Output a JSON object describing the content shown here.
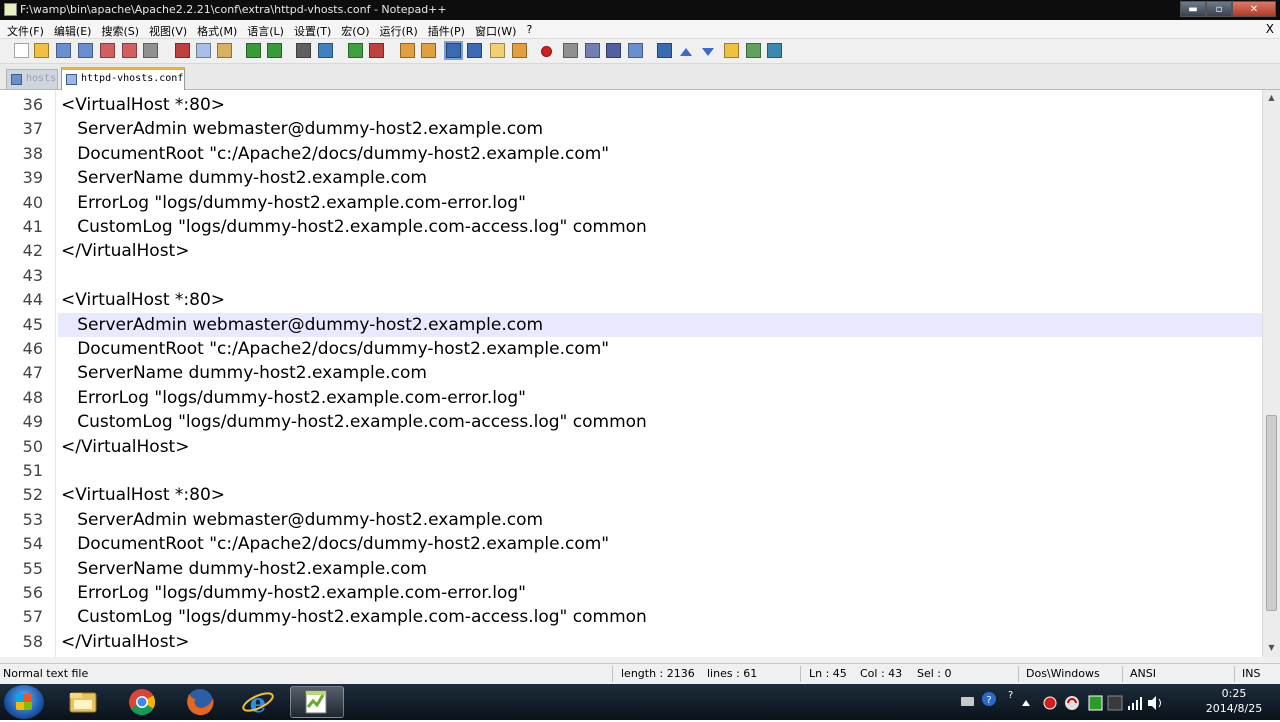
{
  "window": {
    "title": "F:\\wamp\\bin\\apache\\Apache2.2.21\\conf\\extra\\httpd-vhosts.conf - Notepad++",
    "minimize_glyph": "▬",
    "maximize_glyph": "▫",
    "close_glyph": "✕"
  },
  "menu": {
    "items": [
      "文件(F)",
      "编辑(E)",
      "搜索(S)",
      "视图(V)",
      "格式(M)",
      "语言(L)",
      "设置(T)",
      "宏(O)",
      "运行(R)",
      "插件(P)",
      "窗口(W)",
      "?"
    ],
    "close_glyph": "X"
  },
  "toolbar": {
    "icons": [
      "new-file-icon",
      "open-file-icon",
      "save-icon",
      "save-all-icon",
      "close-icon",
      "close-all-icon",
      "print-icon",
      "cut-icon",
      "copy-icon",
      "paste-icon",
      "undo-icon",
      "redo-icon",
      "find-icon",
      "replace-icon",
      "zoom-in-icon",
      "zoom-out-icon",
      "sync-vertical-icon",
      "sync-horizontal-icon",
      "word-wrap-icon",
      "show-all-chars-icon",
      "indent-guide-icon",
      "doc-map-icon",
      "record-macro-icon",
      "stop-macro-icon",
      "play-macro-icon",
      "run-macro-multiple-icon",
      "save-macro-icon",
      "function-list-icon",
      "prev-icon",
      "next-icon",
      "folder-icon",
      "npp-icon",
      "spellcheck-icon"
    ]
  },
  "tabs": [
    {
      "label": "hosts",
      "active": false
    },
    {
      "label": "httpd-vhosts.conf",
      "active": true
    }
  ],
  "editor": {
    "current_line": 45,
    "lines": [
      {
        "num": "36",
        "text": "<VirtualHost *:80>"
      },
      {
        "num": "37",
        "text": "   ServerAdmin webmaster@dummy-host2.example.com"
      },
      {
        "num": "38",
        "text": "   DocumentRoot \"c:/Apache2/docs/dummy-host2.example.com\""
      },
      {
        "num": "39",
        "text": "   ServerName dummy-host2.example.com"
      },
      {
        "num": "40",
        "text": "   ErrorLog \"logs/dummy-host2.example.com-error.log\""
      },
      {
        "num": "41",
        "text": "   CustomLog \"logs/dummy-host2.example.com-access.log\" common"
      },
      {
        "num": "42",
        "text": "</VirtualHost>"
      },
      {
        "num": "43",
        "text": ""
      },
      {
        "num": "44",
        "text": "<VirtualHost *:80>"
      },
      {
        "num": "45",
        "text": "   ServerAdmin webmaster@dummy-host2.example.com"
      },
      {
        "num": "46",
        "text": "   DocumentRoot \"c:/Apache2/docs/dummy-host2.example.com\""
      },
      {
        "num": "47",
        "text": "   ServerName dummy-host2.example.com"
      },
      {
        "num": "48",
        "text": "   ErrorLog \"logs/dummy-host2.example.com-error.log\""
      },
      {
        "num": "49",
        "text": "   CustomLog \"logs/dummy-host2.example.com-access.log\" common"
      },
      {
        "num": "50",
        "text": "</VirtualHost>"
      },
      {
        "num": "51",
        "text": ""
      },
      {
        "num": "52",
        "text": "<VirtualHost *:80>"
      },
      {
        "num": "53",
        "text": "   ServerAdmin webmaster@dummy-host2.example.com"
      },
      {
        "num": "54",
        "text": "   DocumentRoot \"c:/Apache2/docs/dummy-host2.example.com\""
      },
      {
        "num": "55",
        "text": "   ServerName dummy-host2.example.com"
      },
      {
        "num": "56",
        "text": "   ErrorLog \"logs/dummy-host2.example.com-error.log\""
      },
      {
        "num": "57",
        "text": "   CustomLog \"logs/dummy-host2.example.com-access.log\" common"
      },
      {
        "num": "58",
        "text": "</VirtualHost>"
      }
    ]
  },
  "scrollbar": {
    "up_glyph": "▲",
    "down_glyph": "▼"
  },
  "status": {
    "file_type": "Normal text file",
    "length": "length : 2136",
    "lines": "lines : 61",
    "ln": "Ln : 45",
    "col": "Col : 43",
    "sel": "Sel : 0",
    "eol": "Dos\\Windows",
    "encoding": "ANSI",
    "mode": "INS"
  },
  "taskbar": {
    "apps": [
      "explorer-icon",
      "chrome-icon",
      "firefox-icon",
      "ie-icon",
      "notepadpp-icon"
    ],
    "clock_time": "0:25",
    "clock_date": "2014/8/25"
  }
}
